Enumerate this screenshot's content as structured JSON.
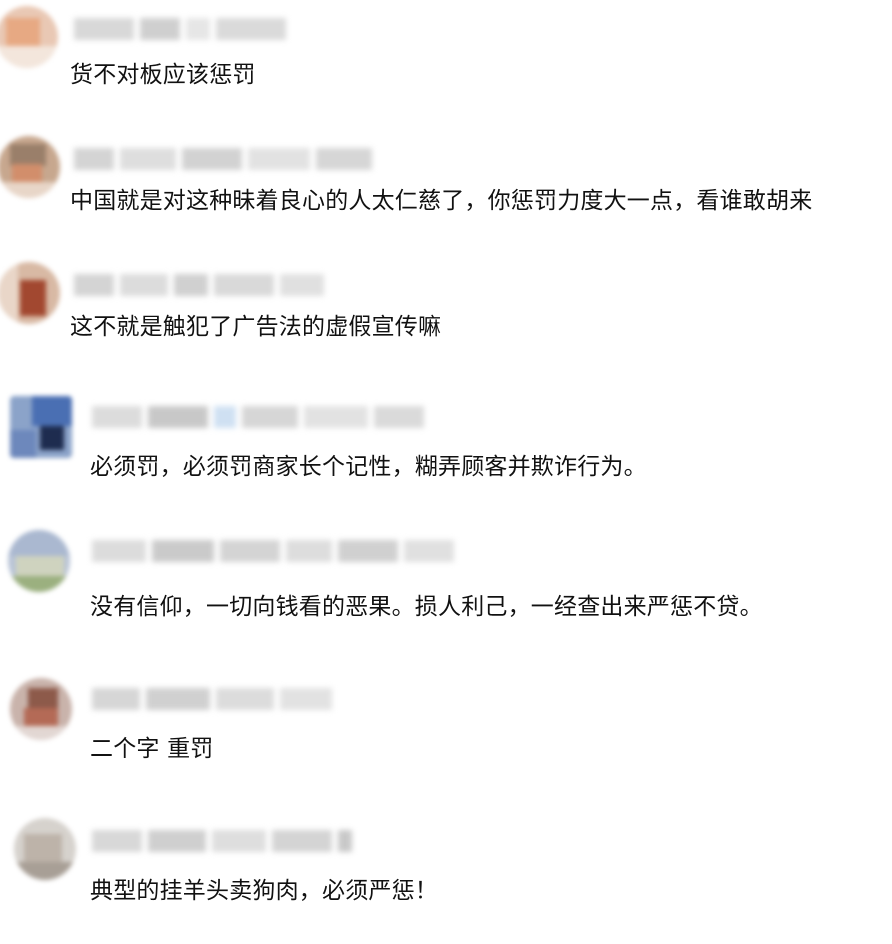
{
  "comments": [
    {
      "text": "货不对板应该惩罚"
    },
    {
      "text": "中国就是对这种昧着良心的人太仁慈了，你惩罚力度大一点，看谁敢胡来"
    },
    {
      "text": "这不就是触犯了广告法的虚假宣传嘛"
    },
    {
      "text": "必须罚，必须罚商家长个记性，糊弄顾客并欺诈行为。"
    },
    {
      "text": "没有信仰，一切向钱看的恶果。损人利己，一经查出来严惩不贷。"
    },
    {
      "text": "二个字 重罚"
    },
    {
      "text": "典型的挂羊头卖狗肉，必须严惩！"
    }
  ]
}
